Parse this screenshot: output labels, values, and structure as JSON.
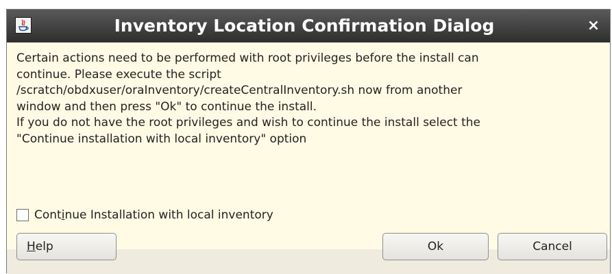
{
  "window": {
    "title": "Inventory Location Confirmation Dialog",
    "close_glyph": "×",
    "icon": "java-app-icon"
  },
  "message": {
    "lines": [
      "Certain actions need to be performed with root privileges before the install can",
      "continue. Please execute the script",
      "/scratch/obdxuser/oraInventory/createCentralInventory.sh now from another",
      "window and then press \"Ok\" to continue the install.",
      "If you do not have the root privileges and wish to continue the install select the",
      "\"Continue installation with local inventory\" option"
    ]
  },
  "checkbox": {
    "label_pre": "Cont",
    "label_mnemonic": "i",
    "label_post": "nue Installation with local inventory",
    "checked": false
  },
  "buttons": {
    "help_mnemonic": "H",
    "help_rest": "elp",
    "ok": "Ok",
    "cancel": "Cancel"
  },
  "colors": {
    "titlebar": "#3c3c3c",
    "content_bg": "#fffbe4",
    "button_bar_bg": "#efecdf"
  }
}
